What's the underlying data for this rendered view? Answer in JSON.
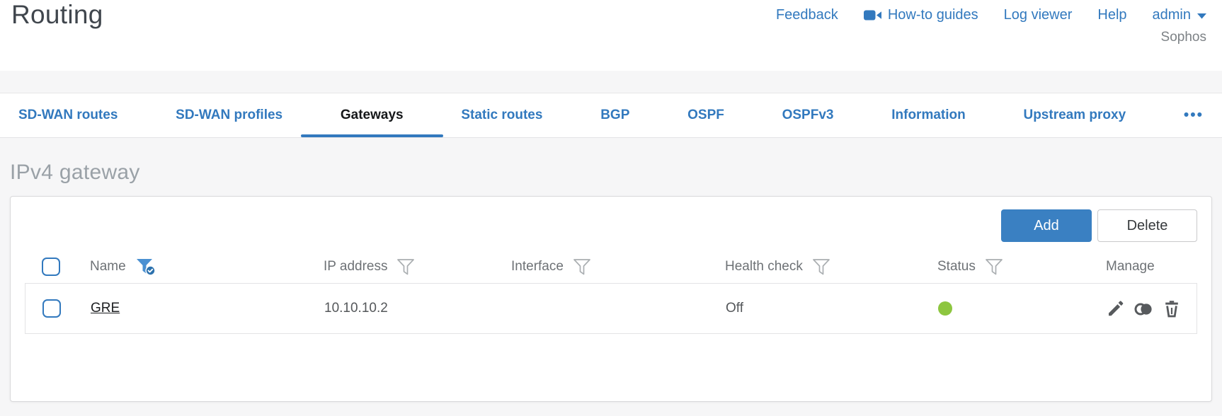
{
  "header": {
    "title": "Routing",
    "nav": {
      "feedback": "Feedback",
      "howto": "How-to guides",
      "logviewer": "Log viewer",
      "help": "Help",
      "user": "admin",
      "brand": "Sophos"
    }
  },
  "tabs": [
    {
      "label": "SD-WAN routes",
      "active": false
    },
    {
      "label": "SD-WAN profiles",
      "active": false
    },
    {
      "label": "Gateways",
      "active": true
    },
    {
      "label": "Static routes",
      "active": false
    },
    {
      "label": "BGP",
      "active": false
    },
    {
      "label": "OSPF",
      "active": false
    },
    {
      "label": "OSPFv3",
      "active": false
    },
    {
      "label": "Information",
      "active": false
    },
    {
      "label": "Upstream proxy",
      "active": false
    },
    {
      "label": "•••",
      "active": false
    }
  ],
  "section": {
    "title": "IPv4 gateway"
  },
  "toolbar": {
    "add": "Add",
    "delete": "Delete"
  },
  "table": {
    "columns": [
      {
        "label": "Name",
        "filter": "active"
      },
      {
        "label": "IP address",
        "filter": "default"
      },
      {
        "label": "Interface",
        "filter": "default"
      },
      {
        "label": "Health check",
        "filter": "default"
      },
      {
        "label": "Status",
        "filter": "default"
      },
      {
        "label": "Manage",
        "filter": "none"
      }
    ],
    "rows": [
      {
        "name": "GRE",
        "ip_address": "10.10.10.2",
        "interface": "",
        "health_check": "Off",
        "status": "up"
      }
    ]
  },
  "colors": {
    "accent_blue": "#3279be",
    "status_green": "#8dc63f"
  }
}
